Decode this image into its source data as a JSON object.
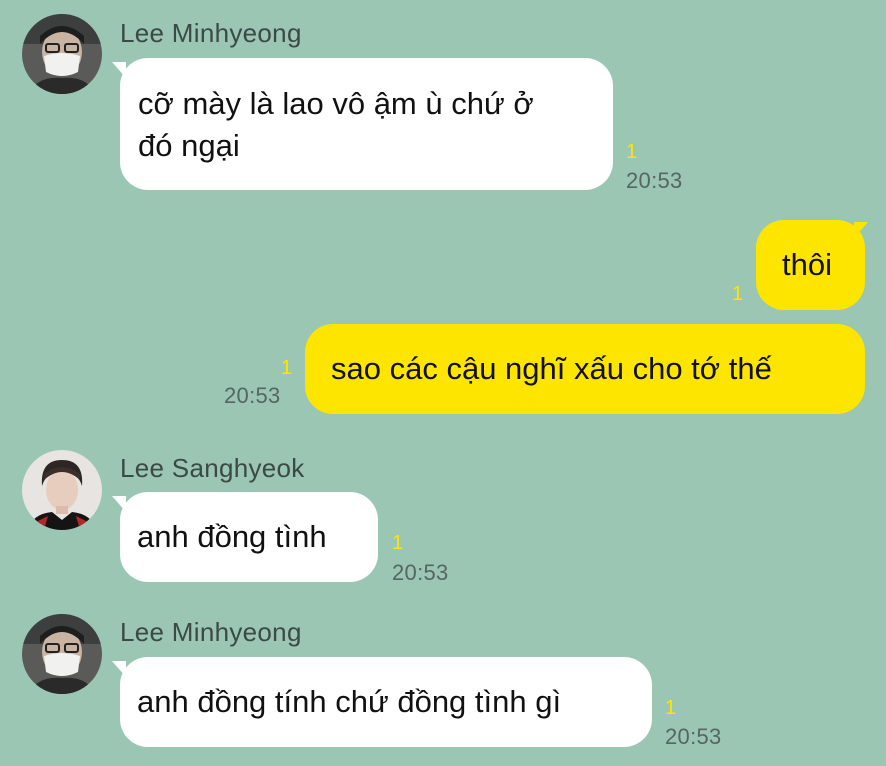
{
  "messages": [
    {
      "direction": "incoming",
      "sender": "Lee Minhyeong",
      "avatar_icon": "profile-photo-masked-man",
      "text": "cỡ mày là lao vô ậm ù chứ ở\nđó ngại",
      "unread": "1",
      "time": "20:53"
    },
    {
      "direction": "outgoing",
      "text": "thôi",
      "unread": "1",
      "time": ""
    },
    {
      "direction": "outgoing",
      "text": "sao các cậu nghĩ xấu cho tớ thế",
      "unread": "1",
      "time": "20:53"
    },
    {
      "direction": "incoming",
      "sender": "Lee Sanghyeok",
      "avatar_icon": "profile-photo-young-man",
      "text": "anh đồng tình",
      "unread": "1",
      "time": "20:53"
    },
    {
      "direction": "incoming",
      "sender": "Lee Minhyeong",
      "avatar_icon": "profile-photo-masked-man",
      "text": "anh đồng tính chứ đồng tình gì",
      "unread": "1",
      "time": "20:53"
    }
  ],
  "colors": {
    "chat_background": "#9bc6b4",
    "incoming_bubble": "#ffffff",
    "outgoing_bubble": "#fee500",
    "unread_count": "#fee500",
    "timestamp": "#55675f"
  }
}
